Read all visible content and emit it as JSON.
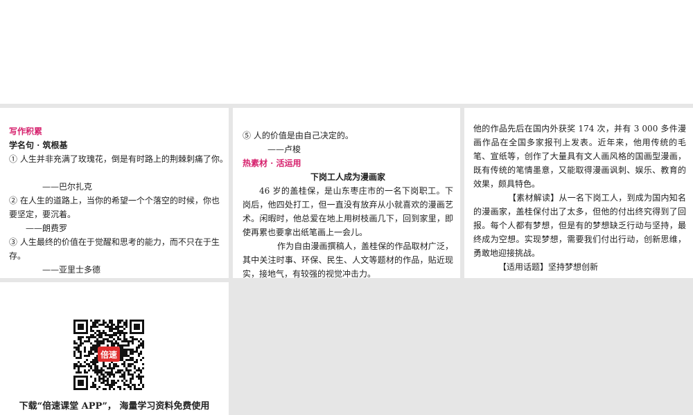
{
  "panel1": {
    "heading": "写作积累",
    "subheading": "学名句 · 筑根基",
    "quote1": "① 人生并非充满了玫瑰花，倒是有时路上的荆棘刺痛了你。",
    "author1": "——巴尔扎克",
    "quote2a": "② 在人生的道路上，当你的希望一个个落空的时候，你也",
    "quote2b": "要坚定，要沉着。",
    "author2": "——朗费罗",
    "quote3a": "③ 人生最终的价值在于觉醒和思考的能力，而不只在于生",
    "quote3b": "存。",
    "author3": "——亚里士多德"
  },
  "panel2": {
    "quote5": "⑤ 人的价值是由自己决定的。",
    "author5": "——卢梭",
    "heading": "热素材 · 活运用",
    "title": "下岗工人成为漫画家",
    "para1": "46 岁的盖桂保，是山东枣庄市的一名下岗职工。下岗后，他四处打工，但一直没有放弃从小就喜欢的漫画艺术。闲暇时，他总爱在地上用树枝画几下，回到家里，即使再累也要拿出纸笔画上一会儿。",
    "para2": "作为自由漫画撰稿人，盖桂保的作品取材广泛，其中关注时事、环保、民生、人文等题材的作品，贴近现实，接地气，有较强的视觉冲击力。"
  },
  "panel3": {
    "para1": "他的作品先后在国内外获奖 174 次，并有 3 000 多件漫画作品在全国多家报刊上发表。近年来，他用传统的毛笔、宣纸等，创作了大量具有文人画风格的国画型漫画，既有传统的笔情墨意，又能取得漫画讽刺、娱乐、教育的效果，颇具特色。",
    "para2": "【素材解读】从一名下岗工人，到成为国内知名的漫画家，盖桂保付出了太多，但他的付出终究得到了回报。每个人都有梦想，但是有的梦想缺乏行动与坚持，最终成为空想。实现梦想，需要我们付出行动，创新思维，勇敢地迎接挑战。",
    "para3": "【适用话题】坚持梦想创新"
  },
  "panel4": {
    "qr_logo": "倍速",
    "caption": "下载“倍速课堂 APP”， 海量学习资料免费使用"
  },
  "colors": {
    "accent": "#d6216d",
    "qr_logo_bg": "#e03030"
  }
}
